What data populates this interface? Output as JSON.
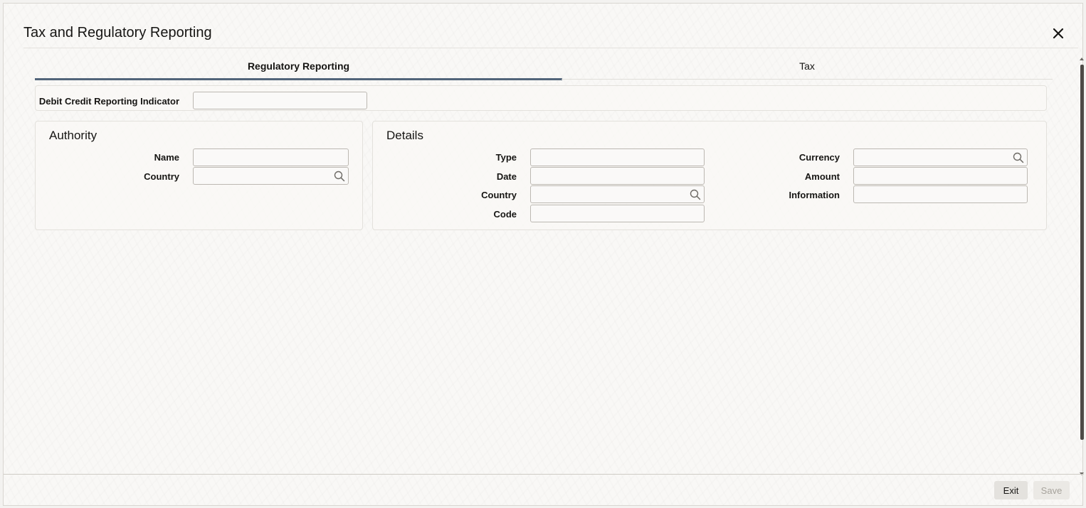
{
  "window": {
    "title": "Tax and Regulatory Reporting"
  },
  "tabs": [
    {
      "label": "Regulatory Reporting",
      "active": true
    },
    {
      "label": "Tax",
      "active": false
    }
  ],
  "top_fields": {
    "debit_credit_indicator": {
      "label": "Debit Credit Reporting Indicator",
      "value": ""
    }
  },
  "authority": {
    "title": "Authority",
    "name": {
      "label": "Name",
      "value": ""
    },
    "country": {
      "label": "Country",
      "value": ""
    }
  },
  "details": {
    "title": "Details",
    "type": {
      "label": "Type",
      "value": ""
    },
    "date": {
      "label": "Date",
      "value": ""
    },
    "country": {
      "label": "Country",
      "value": ""
    },
    "code": {
      "label": "Code",
      "value": ""
    },
    "currency": {
      "label": "Currency",
      "value": ""
    },
    "amount": {
      "label": "Amount",
      "value": ""
    },
    "information": {
      "label": "Information",
      "value": ""
    }
  },
  "footer": {
    "exit_label": "Exit",
    "save_label": "Save",
    "save_enabled": false
  },
  "icons": {
    "close": "close-icon",
    "lov": "search-icon"
  },
  "colors": {
    "active_tab_underline": "#52657a",
    "background": "#f9f8f6"
  }
}
